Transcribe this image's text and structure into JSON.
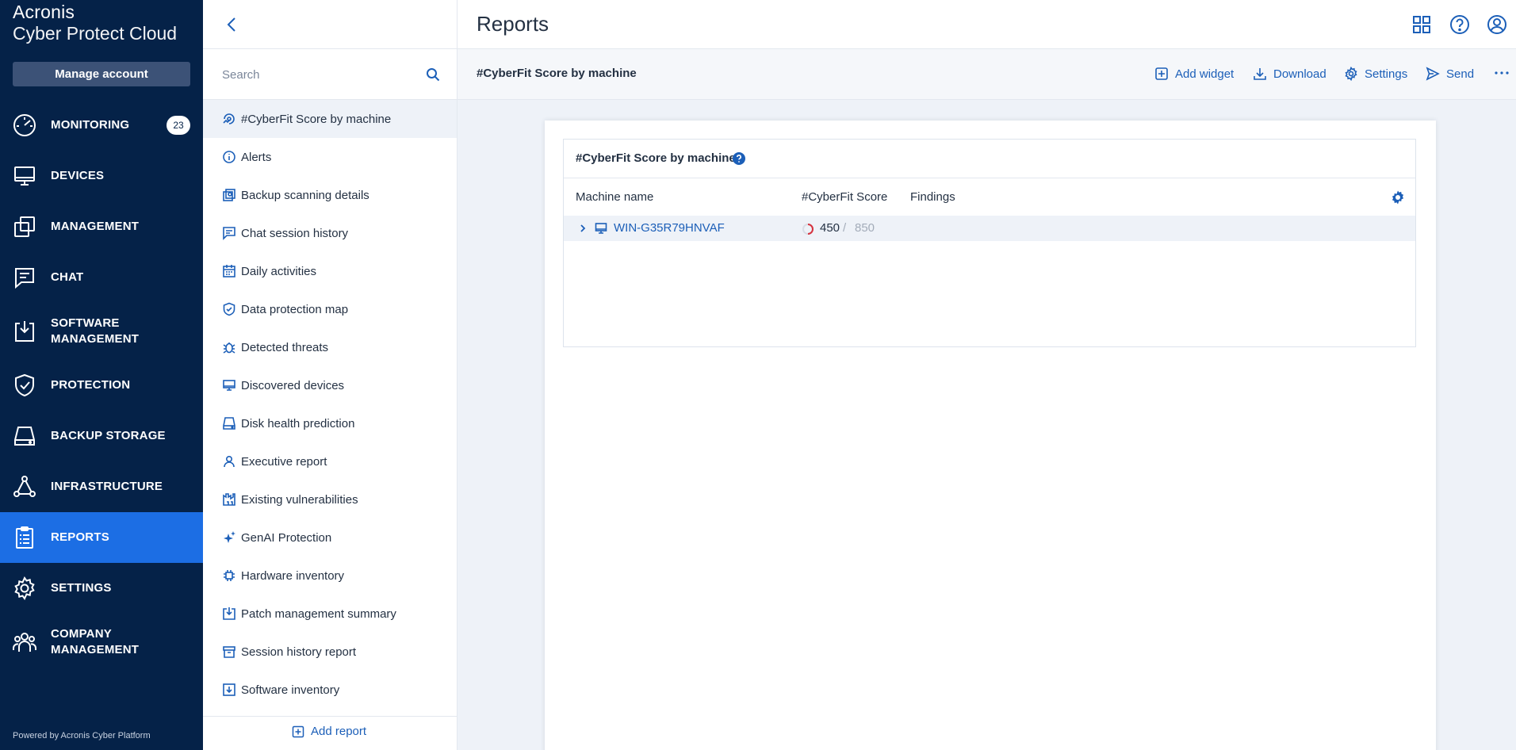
{
  "brand": {
    "line1": "Acronis",
    "line2": "Cyber Protect Cloud"
  },
  "nav": {
    "manage_account": "Manage account",
    "items": [
      {
        "label": "MONITORING",
        "badge": "23",
        "icon": "monitoring-gauge-icon"
      },
      {
        "label": "DEVICES",
        "icon": "monitor-icon"
      },
      {
        "label": "MANAGEMENT",
        "icon": "management-icon"
      },
      {
        "label": "CHAT",
        "icon": "chat-icon"
      },
      {
        "label": "SOFTWARE",
        "label2": "MANAGEMENT",
        "icon": "software-management-icon"
      },
      {
        "label": "PROTECTION",
        "icon": "shield-check-icon"
      },
      {
        "label": "BACKUP STORAGE",
        "icon": "backup-storage-icon"
      },
      {
        "label": "INFRASTRUCTURE",
        "icon": "infrastructure-icon"
      },
      {
        "label": "REPORTS",
        "icon": "reports-clipboard-icon",
        "active": true
      },
      {
        "label": "SETTINGS",
        "icon": "gear-icon"
      },
      {
        "label": "COMPANY",
        "label2": "MANAGEMENT",
        "icon": "people-group-icon"
      }
    ],
    "powered_by": "Powered by Acronis Cyber Platform"
  },
  "report_list": {
    "search_placeholder": "Search",
    "items": [
      {
        "label": "#CyberFit Score by machine",
        "icon": "cyberfit-icon",
        "selected": true
      },
      {
        "label": "Alerts",
        "icon": "info-circle-icon"
      },
      {
        "label": "Backup scanning details",
        "icon": "backup-scan-icon"
      },
      {
        "label": "Chat session history",
        "icon": "chat-icon"
      },
      {
        "label": "Daily activities",
        "icon": "calendar-icon"
      },
      {
        "label": "Data protection map",
        "icon": "shield-check-icon"
      },
      {
        "label": "Detected threats",
        "icon": "bug-icon"
      },
      {
        "label": "Discovered devices",
        "icon": "monitor-icon"
      },
      {
        "label": "Disk health prediction",
        "icon": "disk-icon"
      },
      {
        "label": "Executive report",
        "icon": "person-icon"
      },
      {
        "label": "Existing vulnerabilities",
        "icon": "vulnerability-icon"
      },
      {
        "label": "GenAI Protection",
        "icon": "sparkle-icon"
      },
      {
        "label": "Hardware inventory",
        "icon": "chip-icon"
      },
      {
        "label": "Patch management summary",
        "icon": "patch-icon"
      },
      {
        "label": "Session history report",
        "icon": "archive-icon"
      },
      {
        "label": "Software inventory",
        "icon": "software-inventory-icon"
      }
    ],
    "add_report": "Add report"
  },
  "header": {
    "title": "Reports"
  },
  "toolbar": {
    "report_title": "#CyberFit Score by machine",
    "add_widget": "Add widget",
    "download": "Download",
    "settings": "Settings",
    "send": "Send"
  },
  "widget": {
    "title": "#CyberFit Score by machine",
    "columns": [
      "Machine name",
      "#CyberFit Score",
      "Findings"
    ],
    "rows": [
      {
        "machine": "WIN-G35R79HNVAF",
        "score": "450",
        "separator": "/",
        "max": "850",
        "findings": ""
      }
    ]
  },
  "colors": {
    "nav_bg": "#052248",
    "accent": "#1c6ee4",
    "link": "#1c5fb8",
    "score_ring": "#d6333f"
  }
}
